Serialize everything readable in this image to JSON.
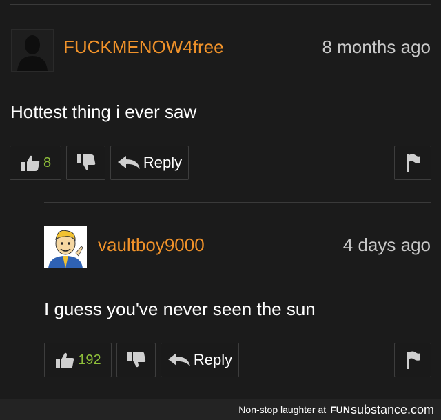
{
  "comments": [
    {
      "username": "FUCKMENOW4free",
      "time": "8 months ago",
      "text": "Hottest thing i ever saw",
      "likes": "8",
      "reply_label": "Reply"
    },
    {
      "username": "vaultboy9000",
      "time": "4 days ago",
      "text": "I guess you've never seen the sun",
      "likes": "192",
      "reply_label": "Reply"
    }
  ],
  "footer": {
    "text": "Non-stop laughter at",
    "brand_fun": "FUN",
    "brand_substance": "substance.com"
  },
  "colors": {
    "background": "#1b1b1b",
    "username": "#f0922a",
    "like_count": "#8fbf3a",
    "border": "#3d3d3d"
  }
}
